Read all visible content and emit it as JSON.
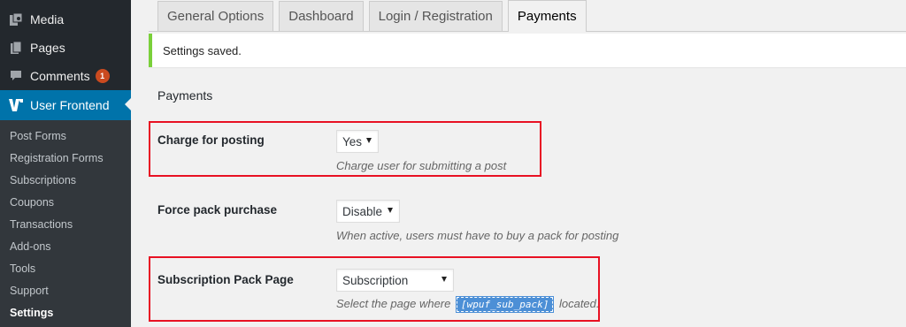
{
  "sidebar": {
    "top_items": [
      {
        "label": "Media",
        "icon": "media-icon"
      },
      {
        "label": "Pages",
        "icon": "pages-icon"
      },
      {
        "label": "Comments",
        "icon": "comments-icon",
        "badge": "1"
      },
      {
        "label": "User Frontend",
        "icon": "wpuf-icon"
      }
    ],
    "sub_items": [
      "Post Forms",
      "Registration Forms",
      "Subscriptions",
      "Coupons",
      "Transactions",
      "Add-ons",
      "Tools",
      "Support",
      "Settings"
    ]
  },
  "tabs": [
    "General Options",
    "Dashboard",
    "Login / Registration",
    "Payments"
  ],
  "notice": "Settings saved.",
  "section_title": "Payments",
  "fields": {
    "charge": {
      "label": "Charge for posting",
      "value": "Yes",
      "description": "Charge user for submitting a post"
    },
    "force": {
      "label": "Force pack purchase",
      "value": "Disable",
      "description": "When active, users must have to buy a pack for posting"
    },
    "subpage": {
      "label": "Subscription Pack Page",
      "value": "Subscription",
      "desc_before": "Select the page where",
      "shortcode": "[wpuf_sub_pack]",
      "desc_after": "located."
    }
  },
  "colors": {
    "sidebar": "#23282d",
    "active": "#0073aa",
    "highlight_border": "#e81123",
    "notice_border": "#7ad03a"
  }
}
